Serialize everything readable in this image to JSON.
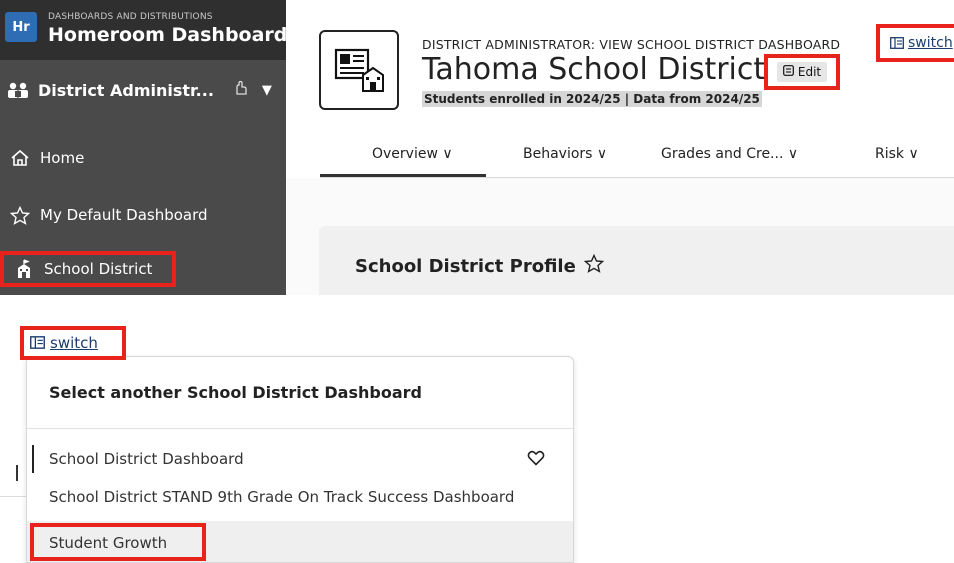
{
  "sidebar": {
    "brand_kicker": "DASHBOARDS AND DISTRIBUTIONS",
    "brand_logo": "Hr",
    "brand_title": "Homeroom Dashboards",
    "role_label": "District Administr...",
    "role_icon": "people-icon",
    "items": [
      {
        "label": "Home",
        "icon": "home-icon"
      },
      {
        "label": "My Default Dashboard",
        "icon": "star-outline-icon"
      },
      {
        "label": "School District",
        "icon": "school-icon",
        "highlighted": true
      }
    ]
  },
  "header": {
    "kicker": "DISTRICT ADMINISTRATOR: VIEW SCHOOL DISTRICT DASHBOARD",
    "title": "Tahoma School District",
    "edit_label": "Edit",
    "subtitle": "Students enrolled in 2024/25 | Data from 2024/25",
    "switch_label": "switch"
  },
  "tabs": [
    {
      "label": "Overview ∨",
      "active": true
    },
    {
      "label": "Behaviors ∨",
      "active": false
    },
    {
      "label": "Grades and Cre... ∨",
      "active": false
    },
    {
      "label": "Risk ∨",
      "active": false
    }
  ],
  "profile": {
    "title": "School District Profile"
  },
  "switch_dropdown": {
    "switch_label": "switch",
    "heading": "Select another School District Dashboard",
    "options": [
      {
        "label": "School District Dashboard",
        "current": true
      },
      {
        "label": "School District STAND 9th Grade On Track Success Dashboard",
        "current": false
      },
      {
        "label": "Student Growth",
        "current": false,
        "highlighted": true
      }
    ]
  },
  "colors": {
    "sidebar_bg": "#4a4a4a",
    "brand_bg": "#2f2f2f",
    "brand_logo_bg": "#2e6db4",
    "highlight_box": "#e8231c",
    "link": "#1b3d6e"
  }
}
